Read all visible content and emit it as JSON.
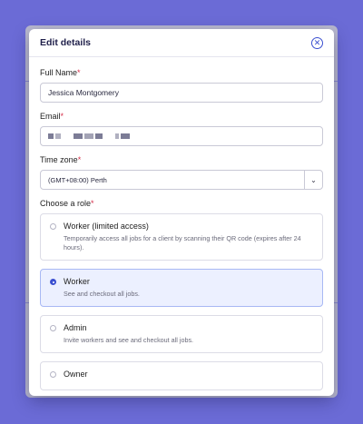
{
  "modal": {
    "title": "Edit details"
  },
  "form": {
    "full_name": {
      "label": "Full Name",
      "required_mark": "*",
      "value": "Jessica Montgomery"
    },
    "email": {
      "label": "Email",
      "required_mark": "*"
    },
    "time_zone": {
      "label": "Time zone",
      "required_mark": "*",
      "value": "(GMT+08:00) Perth"
    },
    "role": {
      "label": "Choose a role",
      "required_mark": "*",
      "options": [
        {
          "title": "Worker (limited access)",
          "description": "Temporarily access all jobs for a client by scanning their QR code (expires after 24 hours).",
          "selected": false
        },
        {
          "title": "Worker",
          "description": "See and checkout all jobs.",
          "selected": true
        },
        {
          "title": "Admin",
          "description": "Invite workers and see and checkout all jobs.",
          "selected": false
        },
        {
          "title": "Owner",
          "description": "",
          "selected": false
        }
      ]
    }
  },
  "colors": {
    "accent": "#3a4fd0",
    "backdrop": "#6b6bd6",
    "selected_bg": "#ecf0ff"
  }
}
